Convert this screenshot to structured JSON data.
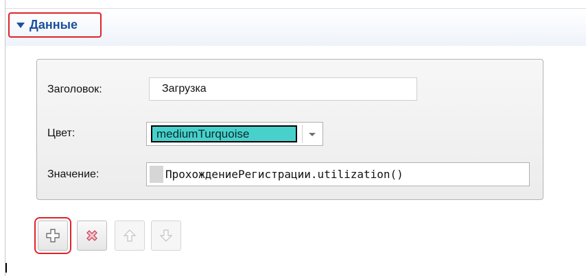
{
  "section": {
    "title": "Данные",
    "accent_color": "#1c4f9c",
    "highlight_color": "#e0222a"
  },
  "form": {
    "title_label": "Заголовок:",
    "title_value": "Загрузка",
    "color_label": "Цвет:",
    "color_value": "mediumTurquoise",
    "color_swatch": "#48d1cc",
    "value_label": "Значение:",
    "value_expression": "ПрохождениеРегистрации.utilization()"
  },
  "toolbar": {
    "buttons": [
      {
        "name": "add",
        "icon": "plus-icon",
        "enabled": true
      },
      {
        "name": "delete",
        "icon": "delete-x-icon",
        "enabled": true
      },
      {
        "name": "move-up",
        "icon": "arrow-up-icon",
        "enabled": false
      },
      {
        "name": "move-down",
        "icon": "arrow-down-icon",
        "enabled": false
      }
    ]
  }
}
